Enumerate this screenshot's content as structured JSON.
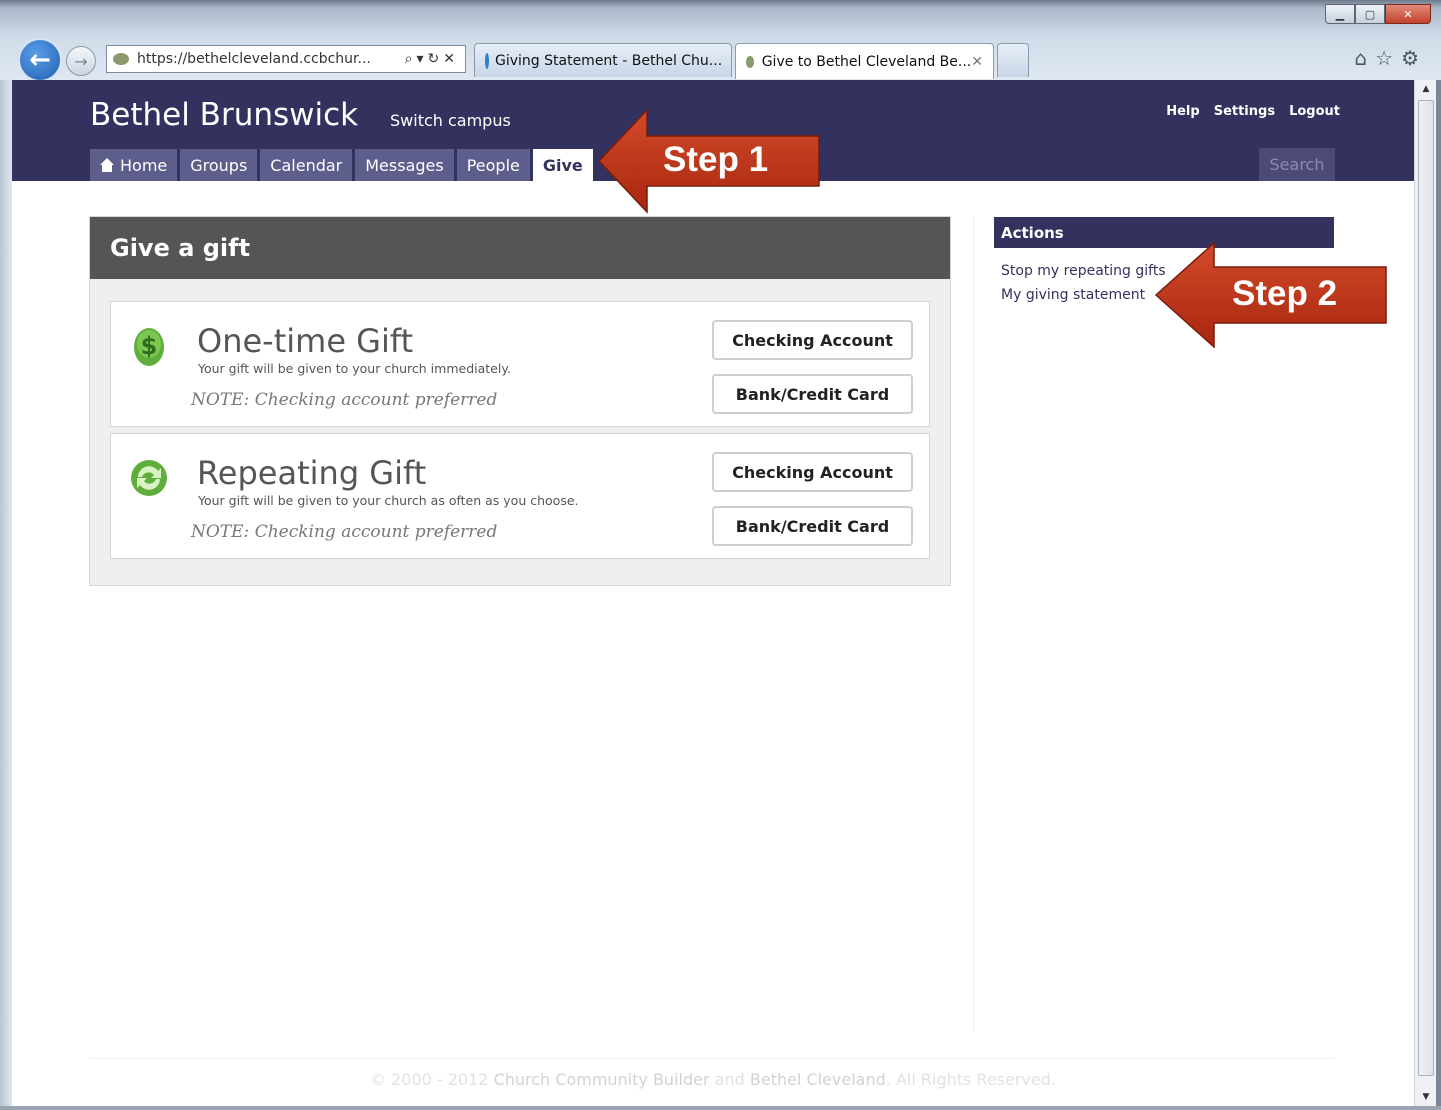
{
  "browser": {
    "address_url": "https://bethelcleveland.ccbchur...",
    "tabs": [
      {
        "label": "Giving Statement - Bethel Chu..."
      },
      {
        "label": "Give to Bethel Cleveland Be..."
      }
    ]
  },
  "site": {
    "title": "Bethel Brunswick",
    "switch_campus": "Switch campus",
    "top_links": {
      "help": "Help",
      "settings": "Settings",
      "logout": "Logout"
    },
    "nav": {
      "home": "Home",
      "groups": "Groups",
      "calendar": "Calendar",
      "messages": "Messages",
      "people": "People",
      "give": "Give"
    },
    "search_placeholder": "Search"
  },
  "main": {
    "heading": "Give a gift",
    "gifts": [
      {
        "title": "One-time Gift",
        "description": "Your gift will be given to your church immediately.",
        "note": "NOTE: Checking account preferred",
        "buttons": [
          "Checking Account",
          "Bank/Credit Card"
        ]
      },
      {
        "title": "Repeating Gift",
        "description": "Your gift will be given to your church as often as you choose.",
        "note": "NOTE: Checking account preferred",
        "buttons": [
          "Checking Account",
          "Bank/Credit Card"
        ]
      }
    ]
  },
  "sidebar": {
    "heading": "Actions",
    "links": [
      "Stop my repeating gifts",
      "My giving statement"
    ]
  },
  "footer": {
    "copyright": "© 2000 - 2012",
    "brand1": "Church Community Builder",
    "and": "and",
    "brand2": "Bethel Cleveland",
    "rights": ". All Rights Reserved."
  },
  "annotations": {
    "step1": "Step 1",
    "step2": "Step 2",
    "arrow_color": "#c0391b"
  }
}
